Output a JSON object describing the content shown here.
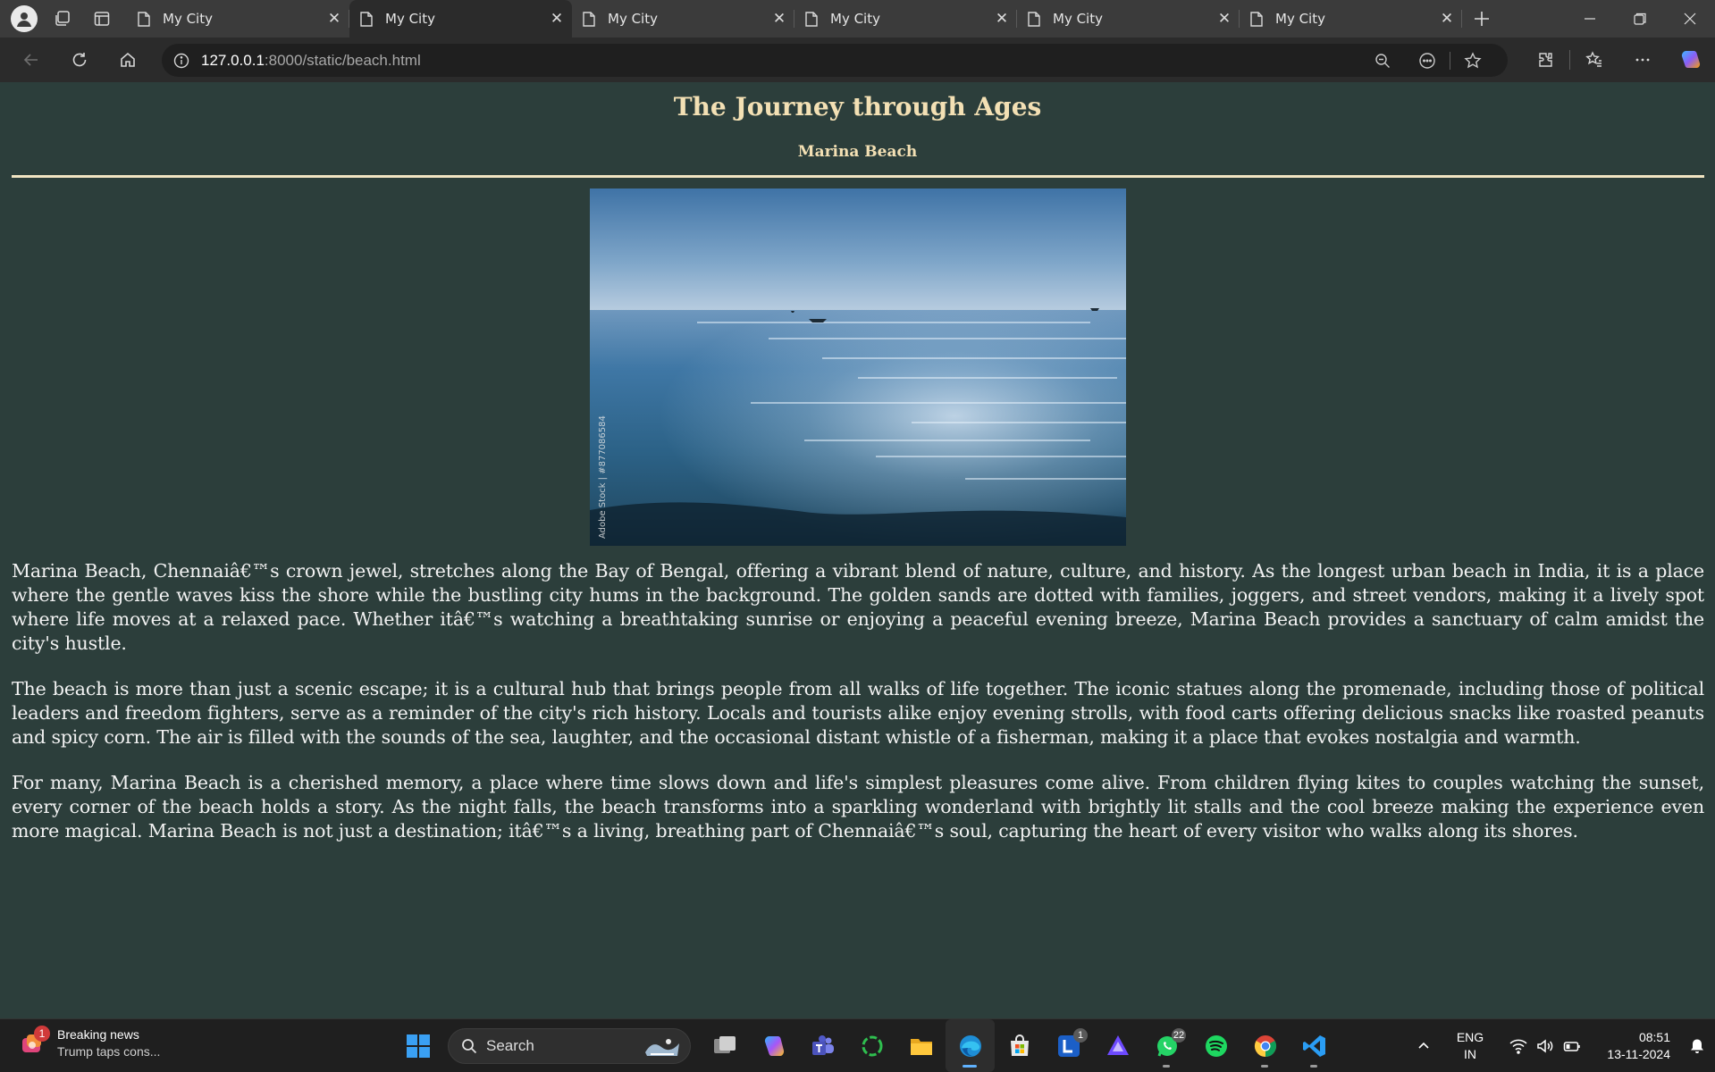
{
  "browser": {
    "tabs": [
      {
        "title": "My City",
        "active": false
      },
      {
        "title": "My City",
        "active": true
      },
      {
        "title": "My City",
        "active": false
      },
      {
        "title": "My City",
        "active": false
      },
      {
        "title": "My City",
        "active": false
      },
      {
        "title": "My City",
        "active": false
      }
    ],
    "url_host": "127.0.0.1",
    "url_rest": ":8000/static/beach.html"
  },
  "page": {
    "title": "The Journey through Ages",
    "subtitle": "Marina Beach",
    "image_watermark": "Adobe Stock | #877086584",
    "paragraphs": [
      "Marina Beach, Chennaiâ€™s crown jewel, stretches along the Bay of Bengal, offering a vibrant blend of nature, culture, and history. As the longest urban beach in India, it is a place where the gentle waves kiss the shore while the bustling city hums in the background. The golden sands are dotted with families, joggers, and street vendors, making it a lively spot where life moves at a relaxed pace. Whether itâ€™s watching a breathtaking sunrise or enjoying a peaceful evening breeze, Marina Beach provides a sanctuary of calm amidst the city's hustle.",
      "The beach is more than just a scenic escape; it is a cultural hub that brings people from all walks of life together. The iconic statues along the promenade, including those of political leaders and freedom fighters, serve as a reminder of the city's rich history. Locals and tourists alike enjoy evening strolls, with food carts offering delicious snacks like roasted peanuts and spicy corn. The air is filled with the sounds of the sea, laughter, and the occasional distant whistle of a fisherman, making it a place that evokes nostalgia and warmth.",
      "For many, Marina Beach is a cherished memory, a place where time slows down and life's simplest pleasures come alive. From children flying kites to couples watching the sunset, every corner of the beach holds a story. As the night falls, the beach transforms into a sparkling wonderland with brightly lit stalls and the cool breeze making the experience even more magical. Marina Beach is not just a destination; itâ€™s a living, breathing part of Chennaiâ€™s soul, capturing the heart of every visitor who walks along its shores."
    ]
  },
  "taskbar": {
    "news_badge": "1",
    "news_title": "Breaking news",
    "news_subtitle": "Trump taps cons...",
    "search_label": "Search",
    "linkedin_badge": "1",
    "whatsapp_badge": "22",
    "lang_line1": "ENG",
    "lang_line2": "IN",
    "time": "08:51",
    "date": "13-11-2024"
  },
  "colors": {
    "page_bg": "#2c3e3b",
    "heading": "#f3e0b4",
    "body_text": "#f2f2f2"
  }
}
